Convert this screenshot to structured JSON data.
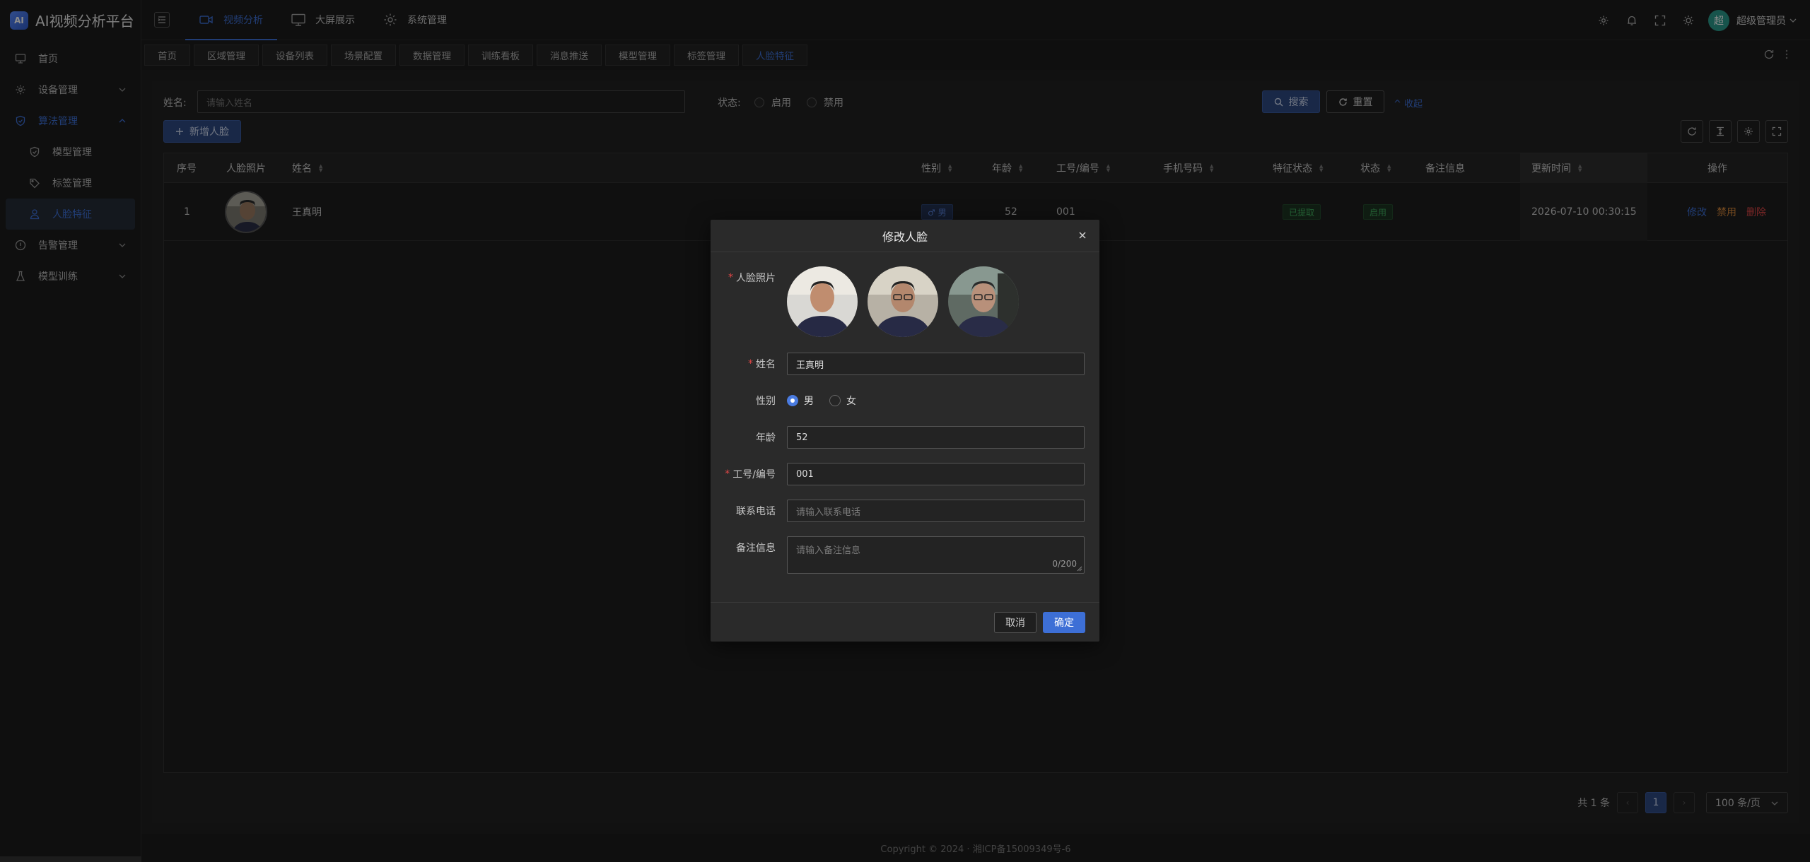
{
  "app": {
    "logo_mark": "AI",
    "title": "AI视频分析平台"
  },
  "sidebar": {
    "items": [
      {
        "label": "首页",
        "icon": "monitor-icon"
      },
      {
        "label": "设备管理",
        "icon": "gear-icon"
      },
      {
        "label": "算法管理",
        "icon": "shield-icon"
      },
      {
        "label": "模型管理",
        "icon": "shield-check-icon"
      },
      {
        "label": "标签管理",
        "icon": "tag-icon"
      },
      {
        "label": "人脸特征",
        "icon": "user-icon"
      },
      {
        "label": "告警管理",
        "icon": "info-circle-icon"
      },
      {
        "label": "模型训练",
        "icon": "flask-icon"
      }
    ]
  },
  "header": {
    "nav": [
      {
        "label": "视频分析",
        "icon": "video-camera-icon"
      },
      {
        "label": "大屏展示",
        "icon": "monitor-icon"
      },
      {
        "label": "系统管理",
        "icon": "gear-icon"
      }
    ],
    "avatar": "超",
    "user_name": "超级管理员"
  },
  "tabs": [
    "首页",
    "区域管理",
    "设备列表",
    "场景配置",
    "数据管理",
    "训练看板",
    "消息推送",
    "模型管理",
    "标签管理",
    "人脸特征"
  ],
  "search": {
    "name_label": "姓名:",
    "name_placeholder": "请输入姓名",
    "status_label": "状态:",
    "status_options": [
      "启用",
      "禁用"
    ],
    "search_button": "搜索",
    "reset_button": "重置",
    "collapse_link": "^ 收起"
  },
  "toolbar": {
    "add_button": "新增人脸"
  },
  "table": {
    "columns": [
      "序号",
      "人脸照片",
      "姓名",
      "性别",
      "年龄",
      "工号/编号",
      "手机号码",
      "特征状态",
      "状态",
      "备注信息",
      "更新时间",
      "操作"
    ],
    "rows": [
      {
        "index": "1",
        "name": "王真明",
        "gender": "♂ 男",
        "age": "52",
        "employee_id": "001",
        "phone": "",
        "feature_status": "已提取",
        "status": "启用",
        "remark": "",
        "updated": "2026-07-10 00:30:15",
        "actions": [
          "修改",
          "禁用",
          "删除"
        ]
      }
    ]
  },
  "pagination": {
    "total": "共 1 条",
    "current": "1",
    "page_size": "100 条/页",
    "prev": "‹",
    "next": "›"
  },
  "footer": {
    "text": "Copyright © 2024 · 湘ICP备15009349号-6"
  },
  "modal": {
    "title": "修改人脸",
    "close": "×",
    "fields": {
      "photo_label": "人脸照片",
      "name_label": "姓名",
      "name_value": "王真明",
      "gender_label": "性别",
      "gender_options": [
        "男",
        "女"
      ],
      "age_label": "年龄",
      "age_value": "52",
      "emp_label": "工号/编号",
      "emp_value": "001",
      "phone_label": "联系电话",
      "phone_placeholder": "请输入联系电话",
      "remark_label": "备注信息",
      "remark_placeholder": "请输入备注信息",
      "remark_count": "0/200"
    },
    "cancel_button": "取消",
    "ok_button": "确定"
  },
  "colors": {
    "accent": "#3d6fd6",
    "danger": "#e04747",
    "warning": "#d7883a",
    "success": "#3faa5b"
  }
}
